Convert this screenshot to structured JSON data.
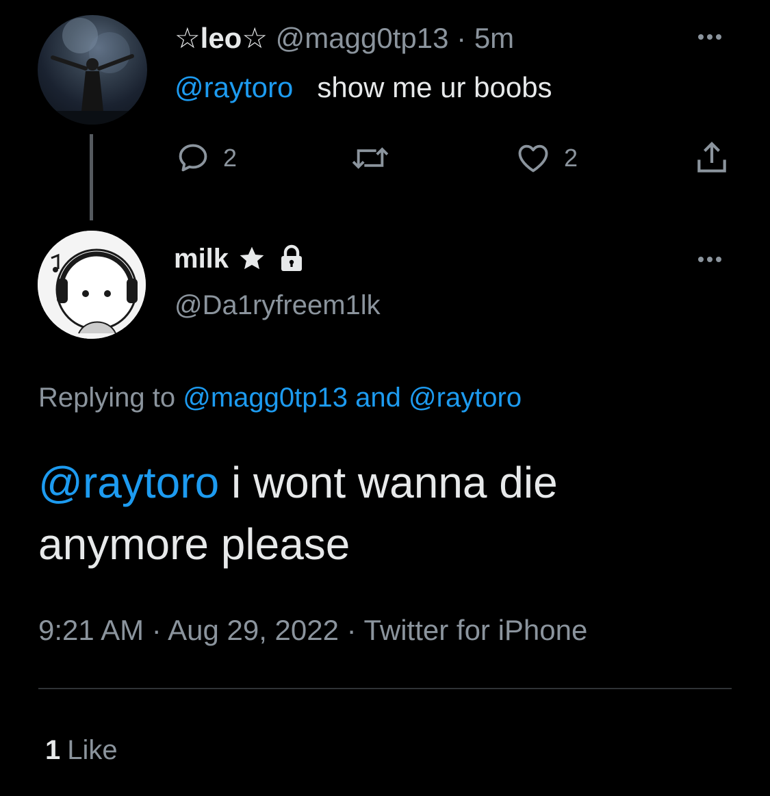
{
  "parent_tweet": {
    "display_name": "☆leo☆",
    "handle": "@magg0tp13",
    "separator": "·",
    "time_ago": "5m",
    "mention": "@raytoro",
    "text": "show me ur boobs",
    "avatar_icon": "concert-avatar",
    "actions": {
      "reply_count": "2",
      "retweet_count": "",
      "like_count": "2"
    }
  },
  "main_tweet": {
    "display_name": "milk",
    "handle": "@Da1ryfreem1lk",
    "badges": [
      "star-icon",
      "lock-icon"
    ],
    "avatar_icon": "headphones-cartoon-avatar",
    "replying_prefix": "Replying to",
    "replying_user1": "@magg0tp13",
    "replying_and": "and",
    "replying_user2": "@raytoro",
    "mention": "@raytoro",
    "text": "i wont wanna die anymore please",
    "timestamp": "9:21 AM · Aug 29, 2022 · Twitter for iPhone",
    "like_count": "1",
    "like_label": "Like"
  },
  "colors": {
    "background": "#000000",
    "text": "#e7e9ea",
    "muted": "#8b949d",
    "accent": "#1d9bf0",
    "divider": "#2f3336"
  }
}
